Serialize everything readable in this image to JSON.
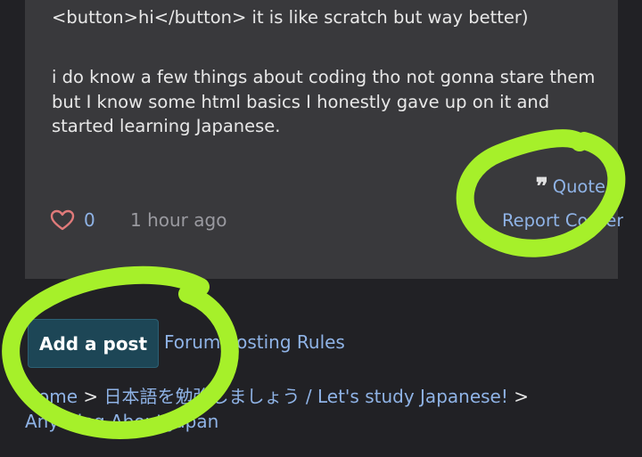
{
  "post": {
    "paragraph_1": "<button>hi</button> it is like scratch but way better)",
    "paragraph_2_lines": [
      "i do know a few things about coding tho not gonna stare them",
      "but I know some html basics I honestly gave up on it and",
      "started learning Japanese."
    ],
    "quote_label": "Quote",
    "report_label": "Report Content",
    "like_count": "0",
    "timestamp": "1 hour ago"
  },
  "actions": {
    "add_post_label": "Add a post",
    "forum_rules_label": "Forum Posting Rules"
  },
  "breadcrumb": {
    "items": [
      "Home",
      "日本語を勉強しましょう / Let's study Japanese!",
      "Anything About Japan"
    ],
    "separator": ">"
  },
  "colors": {
    "background": "#212125",
    "card": "#39393c",
    "link": "#8fb3e6",
    "button": "#1d4656",
    "highlight": "#a6f02a",
    "heart": "#e07a7a"
  },
  "icons": {
    "quote": "quote-icon",
    "like": "heart-icon"
  }
}
